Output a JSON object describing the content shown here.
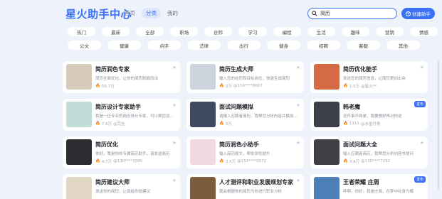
{
  "header": {
    "logo": "星火助手中心",
    "tabs": [
      "首页",
      "分类",
      "我的"
    ],
    "active_tab": 1,
    "search_value": "简历",
    "create_label": "创建助手"
  },
  "categories": [
    [
      "热门",
      "最新",
      "全部",
      "职场",
      "创作",
      "学习",
      "编程",
      "生活",
      "趣味",
      "营销",
      "情感"
    ],
    [
      "公文",
      "健康",
      "点评",
      "法律",
      "出行",
      "健身",
      "招聘",
      "客服",
      "其他"
    ]
  ],
  "cards": [
    {
      "title": "简历润色专家",
      "desc": "简历全面优化，让你的简历脱颖而出",
      "uses": "59.7万",
      "author": "",
      "badge": "",
      "thumb": "#d7cbb9"
    },
    {
      "title": "简历生成大师",
      "desc": "输入您的经历和目标岗位，快速生成简历",
      "uses": "2万",
      "author": "@159****8607",
      "badge": "",
      "thumb": "#cdd4dd"
    },
    {
      "title": "简历优化能手",
      "desc": "发送您的简历信息，让简历更加出众",
      "uses": "1.5万",
      "author": "@星火**",
      "badge": "",
      "thumb": "#d46b45"
    },
    {
      "title": "简历设计专家助手",
      "desc": "我是一位专业的简历设计专家，可以帮您设计简历",
      "uses": "7.6万",
      "author": "@完全",
      "badge": "",
      "thumb": "#c0ddd9"
    },
    {
      "title": "面试问题模拟",
      "desc": "请输入应聘者简历，我帮您分析内容并模拟提问",
      "uses": "5万",
      "author": "",
      "badge": "",
      "thumb": "#3f4a5e"
    },
    {
      "title": "韩老魔",
      "desc": "这件事不简单，我要想好再对你说",
      "uses": "1111",
      "author": "@水墨丹青",
      "badge": "发布",
      "thumb": "#3b4048"
    },
    {
      "title": "简历优化",
      "desc": "你好，我是你的专属简历助手，请发送简历",
      "uses": "4.7万",
      "author": "@138****3580",
      "badge": "",
      "thumb": "#2a2c30"
    },
    {
      "title": "简历润色小助手",
      "desc": "输入简历原文，帮你润色提升",
      "uses": "3.5万",
      "author": "@153****0572",
      "badge": "",
      "thumb": "#f1d9e4"
    },
    {
      "title": "面试问题大全",
      "desc": "输入应聘者简历，我帮您分析内容并提问",
      "uses": "3.4万",
      "author": "@130****7292",
      "badge": "",
      "thumb": "#3d3f44"
    },
    {
      "title": "简历建议大师",
      "desc": "发送你的简历，让我给你提建议",
      "uses": "",
      "author": "",
      "badge": "",
      "thumb": "#e2d6c4"
    },
    {
      "title": "人才测评和职业发展规划专家",
      "desc": "我会根据你的简历为你进行职业分析",
      "uses": "",
      "author": "",
      "badge": "",
      "thumb": "#7d5c3e"
    },
    {
      "title": "王者荣耀 庄周",
      "desc": "呼啊，你好，我是庄周，在梦中化身为蝶",
      "uses": "",
      "author": "",
      "badge": "发布",
      "thumb": "#4d7fb8"
    }
  ]
}
